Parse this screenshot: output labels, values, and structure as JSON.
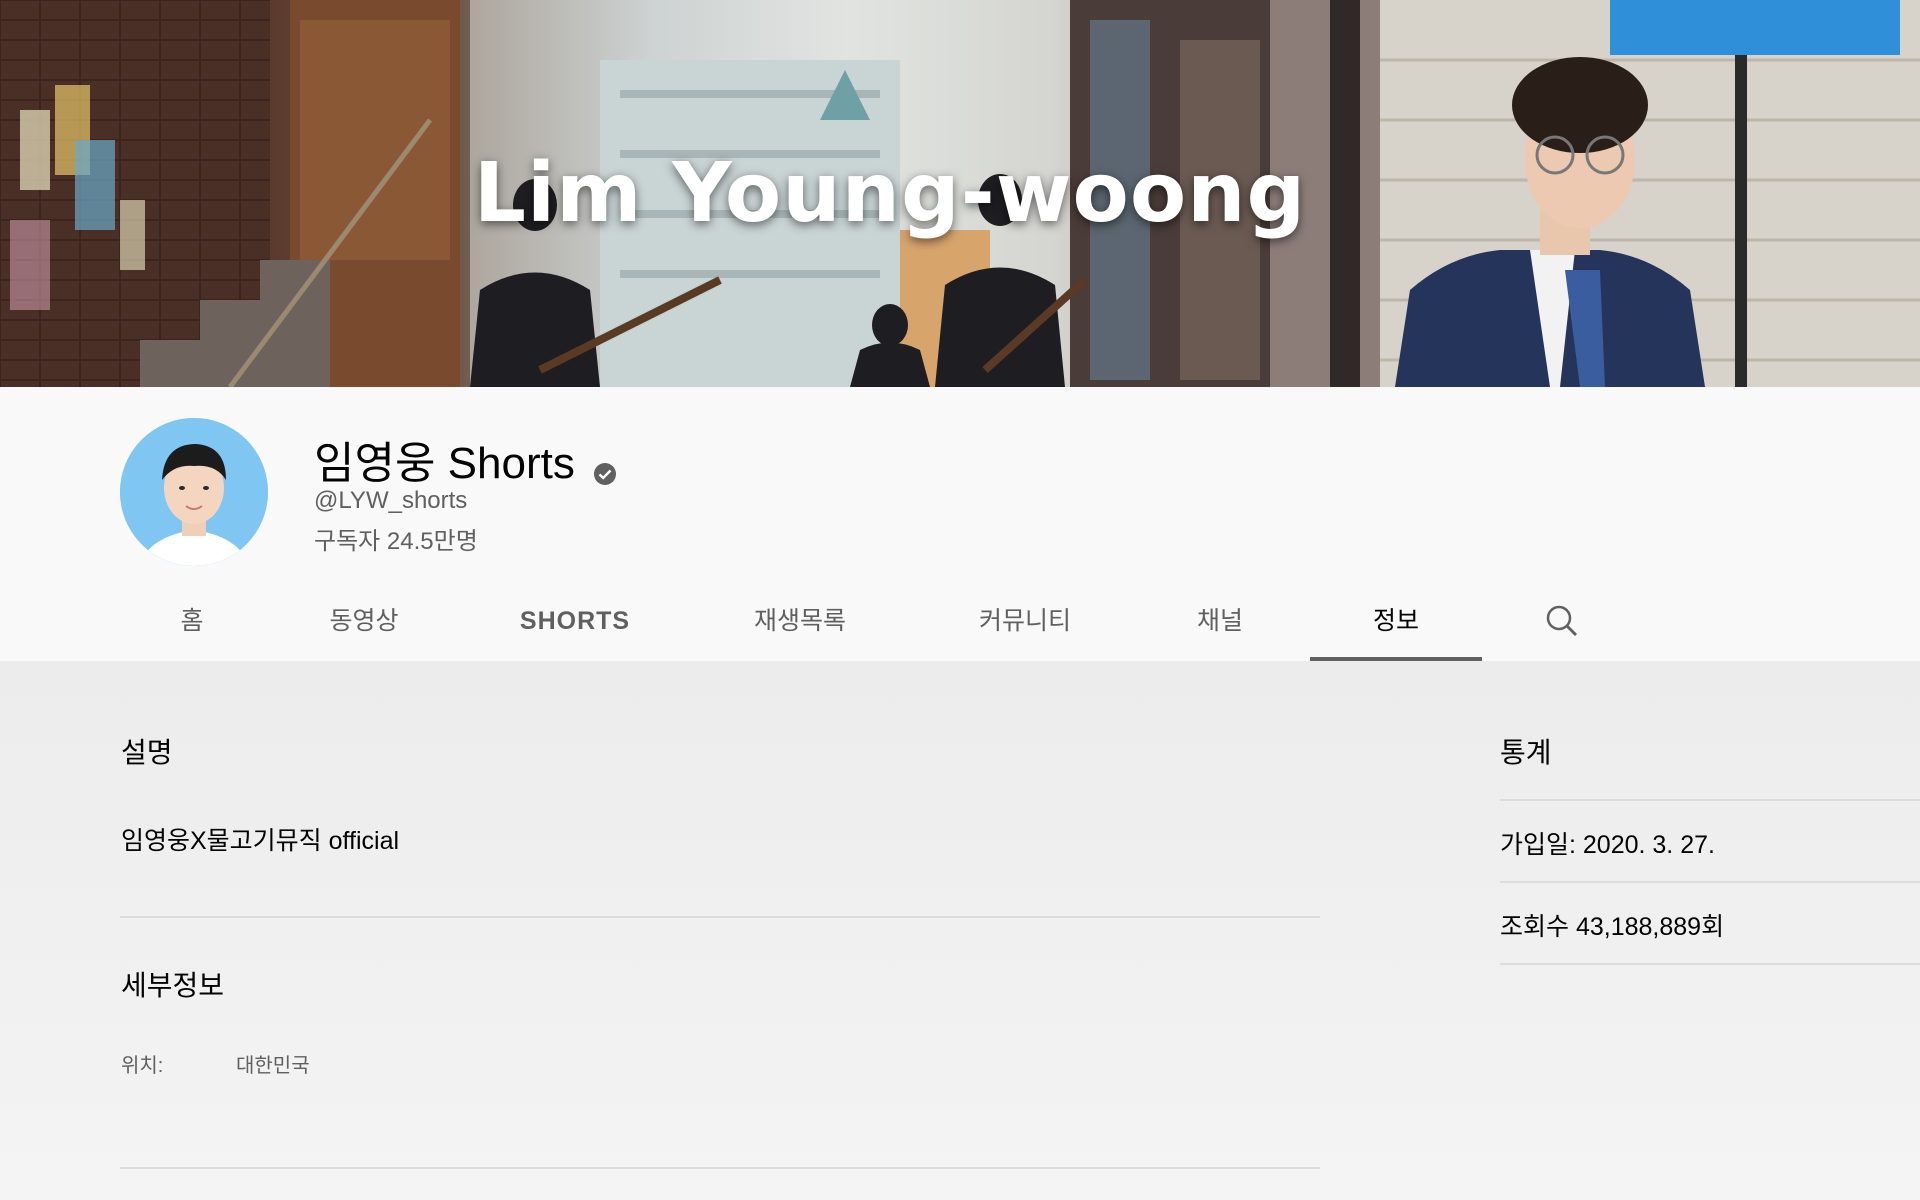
{
  "banner": {
    "title": "Lim Young-woong"
  },
  "channel": {
    "name": "임영웅 Shorts",
    "handle": "@LYW_shorts",
    "subscribers": "구독자 24.5만명"
  },
  "tabs": [
    {
      "label": "홈"
    },
    {
      "label": "동영상"
    },
    {
      "label": "SHORTS"
    },
    {
      "label": "재생목록"
    },
    {
      "label": "커뮤니티"
    },
    {
      "label": "채널"
    },
    {
      "label": "정보",
      "active": true
    }
  ],
  "about": {
    "description_title": "설명",
    "description": "임영웅X물고기뮤직 official",
    "details_title": "세부정보",
    "location_label": "위치:",
    "location_value": "대한민국"
  },
  "stats": {
    "title": "통계",
    "joined": "가입일: 2020. 3. 27.",
    "views": "조회수 43,188,889회"
  },
  "colors": {
    "avatar_bg": "#7fc6f2",
    "tab_underline": "#606060",
    "page_bg": "#f1f1f1"
  }
}
